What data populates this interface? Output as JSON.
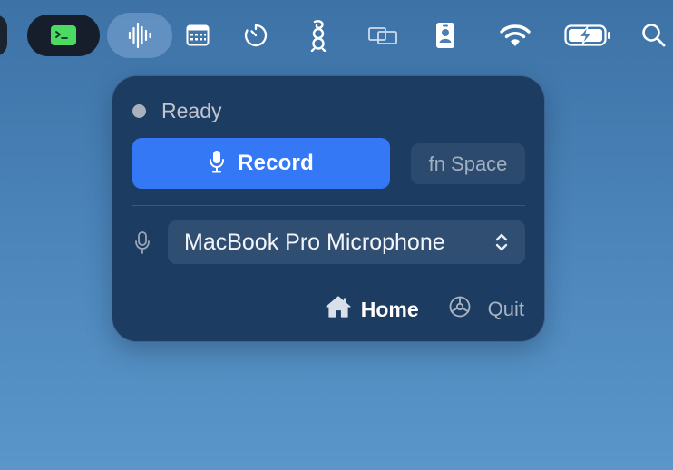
{
  "menubar": {
    "items": [
      {
        "icon": "app-pill-icon"
      },
      {
        "icon": "terminal-icon",
        "color": "#4cd964"
      },
      {
        "icon": "waveform-icon",
        "active": true
      },
      {
        "icon": "calendar-grid-icon"
      },
      {
        "icon": "timer-icon"
      },
      {
        "icon": "wireguard-dragon-icon"
      },
      {
        "icon": "display-mirror-icon"
      },
      {
        "icon": "contact-badge-icon"
      },
      {
        "icon": "wifi-icon"
      },
      {
        "icon": "battery-charging-icon"
      },
      {
        "icon": "search-icon"
      }
    ]
  },
  "popover": {
    "status": {
      "text": "Ready",
      "dot_color": "#a9b1bd"
    },
    "record_button": {
      "label": "Record",
      "icon": "microphone-icon",
      "color": "#3478f6"
    },
    "shortcut": {
      "label": "fn Space"
    },
    "input_device": {
      "icon": "microphone-icon",
      "selected": "MacBook Pro Microphone"
    },
    "footer": {
      "home_label": "Home",
      "home_icon": "house-icon",
      "quit_label": "Quit",
      "quit_icon": "gear-icon"
    }
  }
}
